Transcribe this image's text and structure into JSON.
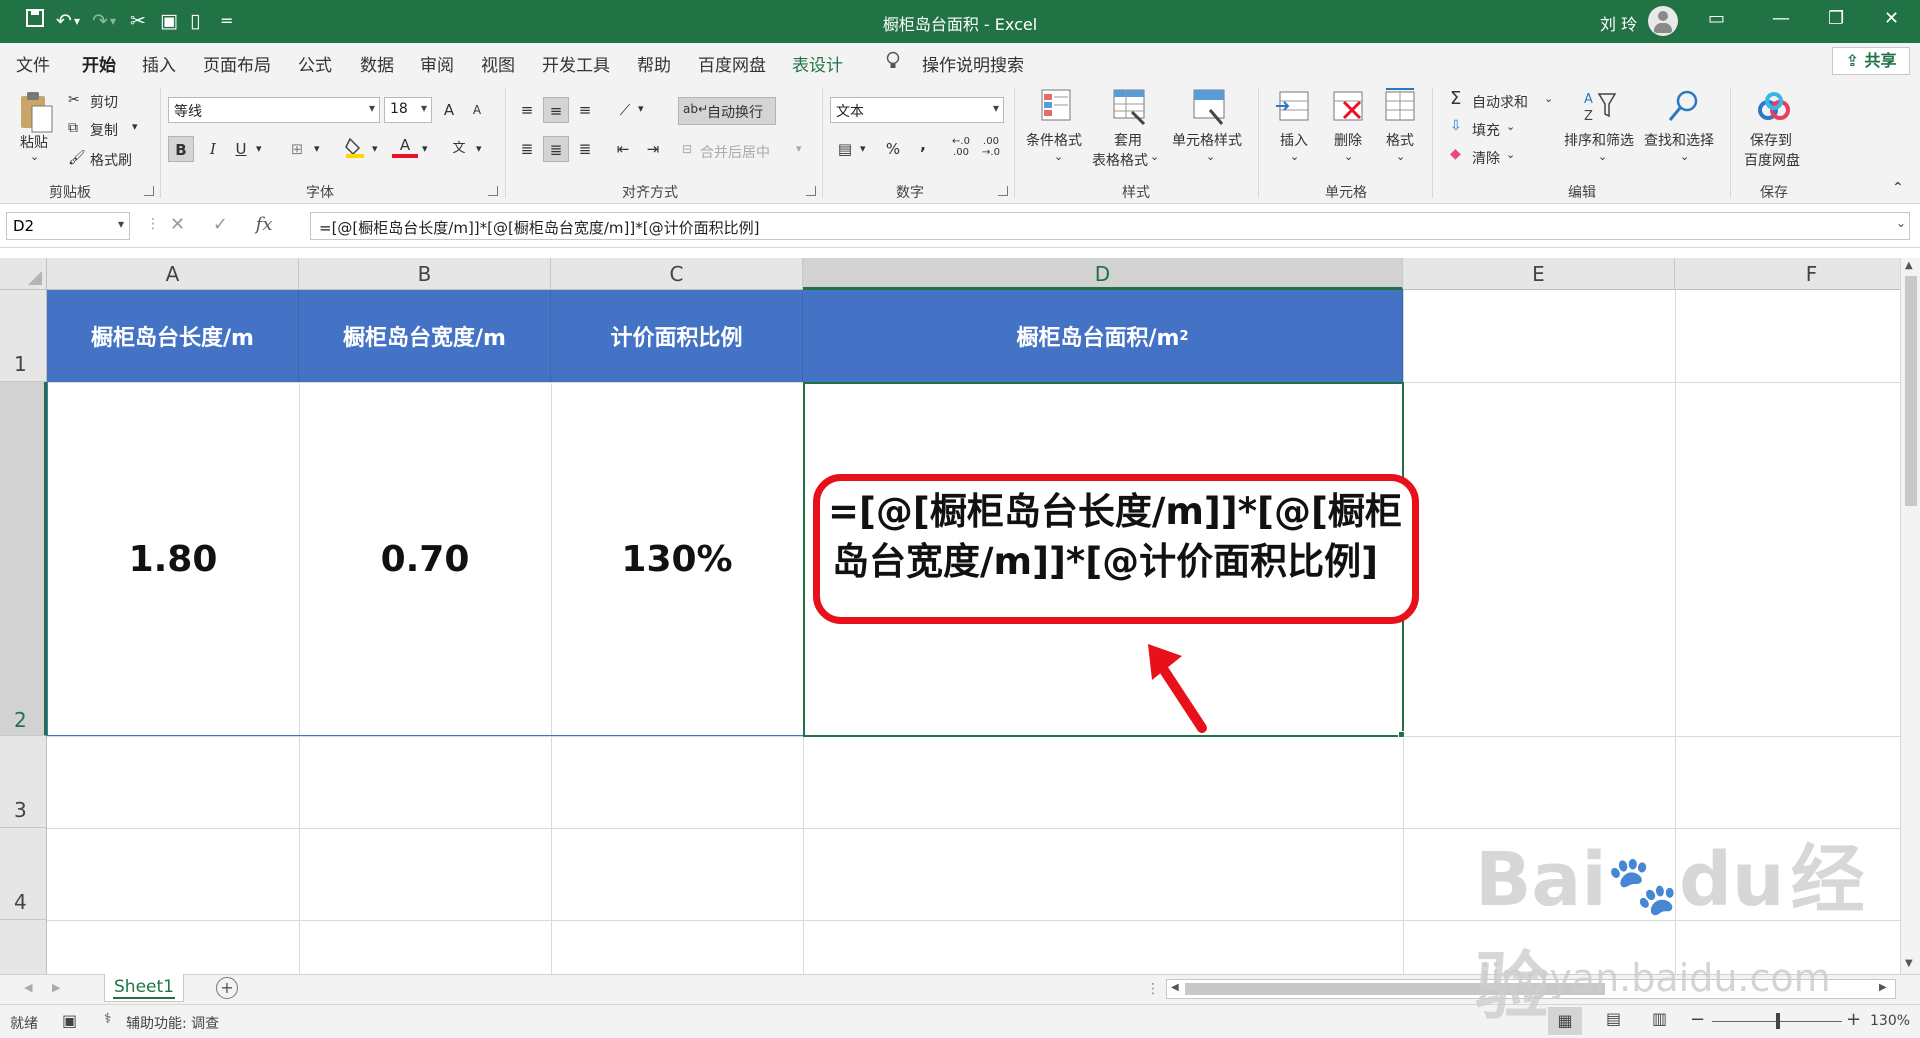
{
  "titlebar": {
    "title": "橱柜岛台面积  -  Excel",
    "user": "刘 玲",
    "qat_customize": "="
  },
  "tabs": [
    "文件",
    "开始",
    "插入",
    "页面布局",
    "公式",
    "数据",
    "审阅",
    "视图",
    "开发工具",
    "帮助",
    "百度网盘",
    "表设计"
  ],
  "active_tab": "开始",
  "tell_me": "操作说明搜索",
  "share": "共享",
  "ribbon": {
    "clipboard": {
      "paste": "粘贴",
      "cut": "剪切",
      "copy": "复制",
      "format_painter": "格式刷",
      "label": "剪贴板"
    },
    "font": {
      "name": "等线",
      "size": "18",
      "label": "字体",
      "bold": "B",
      "italic": "I",
      "underline": "U",
      "grow": "A",
      "shrink": "A",
      "color_letter": "A",
      "phonetic": "文"
    },
    "alignment": {
      "wrap": "自动换行",
      "merge": "合并后居中",
      "label": "对齐方式"
    },
    "number": {
      "format": "文本",
      "percent": "%",
      "comma": ",",
      "label": "数字",
      "inc_decimal": "←.0\n.00",
      "dec_decimal": ".00\n→.0"
    },
    "styles": {
      "conditional": "条件格式",
      "table_format_1": "套用",
      "table_format_2": "表格格式",
      "cell_styles": "单元格样式",
      "label": "样式"
    },
    "cells": {
      "insert": "插入",
      "delete": "删除",
      "format": "格式",
      "label": "单元格"
    },
    "editing": {
      "autosum": "自动求和",
      "fill": "填充",
      "clear": "清除",
      "sort": "排序和筛选",
      "find": "查找和选择",
      "label": "编辑"
    },
    "save": {
      "save_1": "保存到",
      "save_2": "百度网盘",
      "label": "保存"
    }
  },
  "formula_bar": {
    "name_box": "D2",
    "fx": "fx",
    "formula": "=[@[橱柜岛台长度/m]]*[@[橱柜岛台宽度/m]]*[@计价面积比例]"
  },
  "columns": [
    "A",
    "B",
    "C",
    "D",
    "E",
    "F"
  ],
  "rows": [
    "1",
    "2",
    "3",
    "4"
  ],
  "table": {
    "headers": [
      "橱柜岛台长度/m",
      "橱柜岛台宽度/m",
      "计价面积比例",
      "橱柜岛台面积/m"
    ],
    "area_unit_sup": "2",
    "values": [
      "1.80",
      "0.70",
      "130%"
    ]
  },
  "callout": {
    "line1": "=[@[橱柜岛台长度/m]]*[@[橱柜",
    "line2": "岛台宽度/m]]*[@计价面积比例]",
    "color": "#e8101a"
  },
  "sheet_tabs": [
    "Sheet1"
  ],
  "statusbar": {
    "ready": "就绪",
    "accessibility": "辅助功能: 调查",
    "zoom": "130%"
  },
  "watermark": {
    "brand": "Bai",
    "brand2": "du",
    "cn": "经验",
    "url": "jingyan.baidu.com"
  },
  "colors": {
    "excel_green": "#217346",
    "table_header": "#4472c4"
  }
}
